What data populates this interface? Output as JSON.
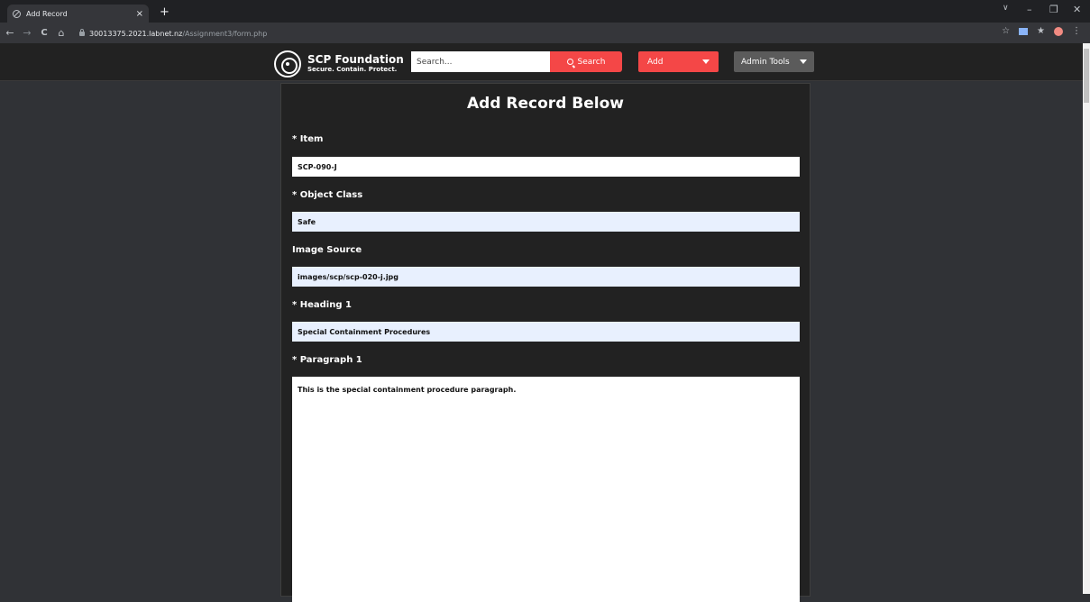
{
  "browser": {
    "tab_title": "Add Record",
    "tab_close": "×",
    "new_tab": "+",
    "url_host": "30013375.2021.labnet.nz",
    "url_path": "/Assignment3/form.php",
    "nav_back": "←",
    "nav_forward": "→",
    "nav_reload": "C",
    "nav_home": "⌂",
    "win_min": "–",
    "win_restore": "❐",
    "win_close": "✕",
    "tab_search": "∨",
    "star": "☆",
    "extensions": "★",
    "menu": "⋮"
  },
  "navbar": {
    "logo_line1": "SCP Foundation",
    "logo_line2": "Secure. Contain. Protect.",
    "search_placeholder": "Search...",
    "search_button": "Search",
    "add_button": "Add",
    "admin_button": "Admin Tools"
  },
  "form": {
    "heading": "Add Record Below",
    "item_label": "* Item",
    "item_value": "SCP-090-J",
    "object_class_label": "* Object Class",
    "object_class_value": "Safe",
    "image_source_label": "Image Source",
    "image_source_value": "images/scp/scp-020-j.jpg",
    "heading1_label": "* Heading 1",
    "heading1_value": "Special Containment Procedures",
    "paragraph1_label": "* Paragraph 1",
    "paragraph1_value": "This is the special containment procedure paragraph."
  }
}
